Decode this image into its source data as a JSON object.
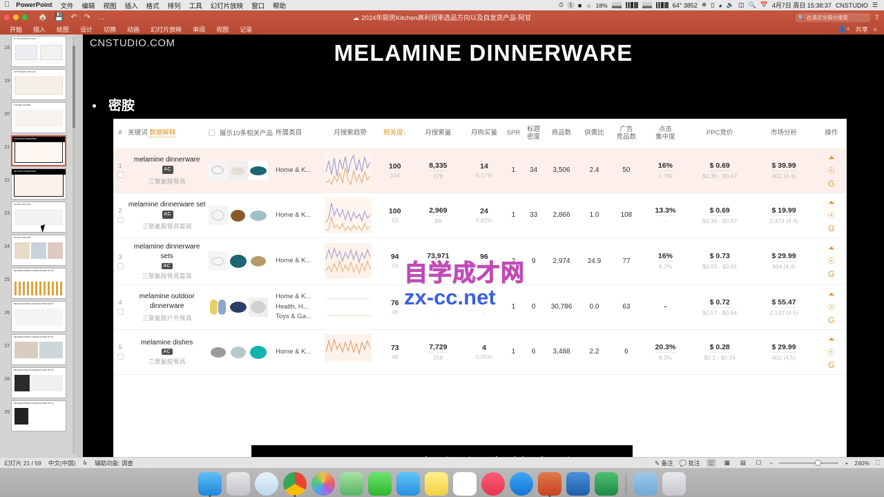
{
  "macbar": {
    "apple_icon": "apple-icon",
    "app_name": "PowerPoint",
    "menus": [
      "文件",
      "编辑",
      "视图",
      "插入",
      "格式",
      "排列",
      "工具",
      "幻灯片放映",
      "窗口",
      "帮助"
    ],
    "battery": "18%",
    "temp": "64° 3852",
    "datetime": "4月7日 周日  15:38:37",
    "user": "CNSTUDIO",
    "menu_icon": "hamburger-icon"
  },
  "titlebar": {
    "home_icon": "home-icon",
    "save_icon": "save-icon",
    "undo_icon": "undo-icon",
    "redo_icon": "redo-icon",
    "more_icon": "more-icon",
    "document_title": "2024年厨房Kitchen高利润率选品方向以及自发货产品-阿甘",
    "search_placeholder": "在演示文稿中搜索",
    "share_label": "共享",
    "share_icon": "share-person-icon",
    "chevron_icon": "chevron-down-icon"
  },
  "ribbon": {
    "tabs": [
      "开始",
      "插入",
      "绘图",
      "设计",
      "切换",
      "动画",
      "幻灯片放映",
      "审阅",
      "视图",
      "记录"
    ],
    "active_tab": "开始"
  },
  "thumbnails": {
    "items": [
      {
        "num": "18",
        "title": "HTTPS://WWW.CPSC.GOV"
      },
      {
        "num": "19",
        "title": "HTTPS://WWW.CPSC.GOV"
      },
      {
        "num": "20",
        "title": "KITCHEN CLEANER"
      },
      {
        "num": "21",
        "title": "MELAMINE DINNERWARE"
      },
      {
        "num": "22",
        "title": "MELAMINE DINNERWARE"
      },
      {
        "num": "23",
        "title": "PICASSO WALL ART"
      },
      {
        "num": "24",
        "title": "PICASSO WALL ART"
      },
      {
        "num": "25",
        "title": "BEVERAGE FRIDGE UNDERCOUNTER TIKTOK"
      },
      {
        "num": "26",
        "title": "BEVERAGE FRIDGE UNDERCOUNTER TIKTOK"
      },
      {
        "num": "27",
        "title": "BEVERAGE FRIDGE UNDERCOUNTER TIKTOK"
      },
      {
        "num": "28",
        "title": "BEVERAGE FRIDGE UNDERCOUNTER TIKTOK"
      },
      {
        "num": "29",
        "title": "BEVERAGE FRIDGE UNDERCOUNTER TIKTOK"
      }
    ],
    "selected": "21"
  },
  "slide": {
    "watermark": "CNSTUDIO.COM",
    "title": "MELAMINE DINNERWARE",
    "bullet_text": "密胺"
  },
  "screenshot_watermark": {
    "line1": "自学成才网",
    "line2": "zx-cc.net"
  },
  "table": {
    "headers": {
      "index": "#",
      "keyword": "关键词",
      "data_explain": "数据解释",
      "show_related": "展示10条相关产品",
      "category": "所属类目",
      "search_trend": "月搜索趋势",
      "relevance": "相关度",
      "relevance_arrow": "↓",
      "search_volume": "月搜索量",
      "purchase_volume": "月购买量",
      "spr": "SPR",
      "title_density_l1": "标题",
      "title_density_l2": "密度",
      "product_count": "商品数",
      "supply_demand": "供需比",
      "ad_comp_l1": "广告",
      "ad_comp_l2": "竞品数",
      "click_conc_l1": "点击",
      "click_conc_l2": "集中度",
      "ppc_bid": "PPC竞价",
      "market_analysis": "市场分析",
      "operation": "操作"
    },
    "rows": [
      {
        "index": "1",
        "keyword": "melamine dinnerware",
        "badge": "AC",
        "keyword_cn": "三聚氰胺餐具",
        "category": [
          "Home & K..."
        ],
        "relevance": "100",
        "relevance_sub": "104",
        "search_volume": "8,335",
        "search_volume_sub": "278",
        "purchase_volume": "14",
        "purchase_rate": "0.17%",
        "spr": "1",
        "title_density": "34",
        "product_count": "3,506",
        "supply_demand": "2.4",
        "ad_competitors": "50",
        "click_conc": "16%",
        "click_conc_sub": "1.7%",
        "ppc_bid": "$ 0.69",
        "ppc_range": "$0.36 - $0.87",
        "market_price": "$ 39.99",
        "market_sub": "402 (4.4)"
      },
      {
        "index": "2",
        "keyword": "melamine dinnerware set",
        "badge": "AC",
        "keyword_cn": "三聚氰胺餐具套装",
        "category": [
          "Home & K..."
        ],
        "relevance": "100",
        "relevance_sub": "63",
        "search_volume": "2,969",
        "search_volume_sub": "99",
        "purchase_volume": "24",
        "purchase_rate": "0.82%",
        "spr": "1",
        "title_density": "33",
        "product_count": "2,866",
        "supply_demand": "1.0",
        "ad_competitors": "108",
        "click_conc": "13.3%",
        "click_conc_sub": "-",
        "ppc_bid": "$ 0.69",
        "ppc_range": "$0.36 - $0.87",
        "market_price": "$ 19.99",
        "market_sub": "2,473 (4.4)"
      },
      {
        "index": "3",
        "keyword": "melamine dinnerware sets",
        "badge": "AC",
        "keyword_cn": "三聚氰胺餐具套装",
        "category": [
          "Home & K..."
        ],
        "relevance": "94",
        "relevance_sub": "59",
        "search_volume": "73,971",
        "search_volume_sub": "2,466",
        "purchase_volume": "96",
        "purchase_rate": "0.13%",
        "spr": "2",
        "title_density": "9",
        "product_count": "2,974",
        "supply_demand": "24.9",
        "ad_competitors": "77",
        "click_conc": "16%",
        "click_conc_sub": "8.2%",
        "ppc_bid": "$ 0.73",
        "ppc_range": "$0.55 - $0.81",
        "market_price": "$ 29.99",
        "market_sub": "364 (4.4)"
      },
      {
        "index": "4",
        "keyword": "melamine outdoor dinnerware",
        "badge": "",
        "keyword_cn": "三聚氰胺户外餐具",
        "category": [
          "Home & K...",
          "Health, H...",
          "Toys & Ga..."
        ],
        "relevance": "76",
        "relevance_sub": "48",
        "search_volume": "-",
        "search_volume_sub": "-",
        "purchase_volume": "-",
        "purchase_rate": "-",
        "spr": "1",
        "title_density": "0",
        "product_count": "30,786",
        "supply_demand": "0.0",
        "ad_competitors": "63",
        "click_conc": "-",
        "click_conc_sub": "",
        "ppc_bid": "$ 0.72",
        "ppc_range": "$0.57 - $0.94",
        "market_price": "$ 55.47",
        "market_sub": "1,142 (4.5)"
      },
      {
        "index": "5",
        "keyword": "melamine dishes",
        "badge": "AC",
        "keyword_cn": "三聚氰胺餐具",
        "category": [
          "Home & K..."
        ],
        "relevance": "73",
        "relevance_sub": "46",
        "search_volume": "7,729",
        "search_volume_sub": "258",
        "purchase_volume": "4",
        "purchase_rate": "0.05%",
        "spr": "1",
        "title_density": "6",
        "product_count": "3,488",
        "supply_demand": "2.2",
        "ad_competitors": "6",
        "click_conc": "20.3%",
        "click_conc_sub": "8.3%",
        "ppc_bid": "$ 0.28",
        "ppc_range": "$0.2 - $0.34",
        "market_price": "$ 29.99",
        "market_sub": "402 (4.5)"
      }
    ],
    "action_icons": [
      "chart-bar-icon",
      "more-circle-icon",
      "google-icon"
    ]
  },
  "subtitle": {
    "text": "melamine它有化学的名称"
  },
  "statusbar": {
    "slide_counter": "幻灯片 21 / 59",
    "language": "中文(中国)",
    "accessibility_icon": "accessibility-icon",
    "accessibility": "辅助功能: 调查",
    "notes_icon": "notes-icon",
    "notes_label": "备注",
    "comments_icon": "comments-icon",
    "comments_label": "批注",
    "view_normal_icon": "view-normal-icon",
    "view_sorter_icon": "view-sorter-icon",
    "view_reading_icon": "view-reading-icon",
    "view_show_icon": "view-slideshow-icon",
    "zoom_out": "−",
    "zoom_in": "+",
    "zoom_level": "240%",
    "fit_icon": "fit-slide-icon"
  },
  "dock": {
    "apps": [
      "finder",
      "launchpad",
      "safari",
      "chrome",
      "photos",
      "maps",
      "messages",
      "mail",
      "notes",
      "calendar",
      "music",
      "appstore",
      "powerpoint",
      "word",
      "excel",
      "folder",
      "trash"
    ]
  },
  "colors": {
    "ppt_accent": "#bd4f3a",
    "table_accent": "#e8921f",
    "row_highlight": "#fdf0ec"
  }
}
